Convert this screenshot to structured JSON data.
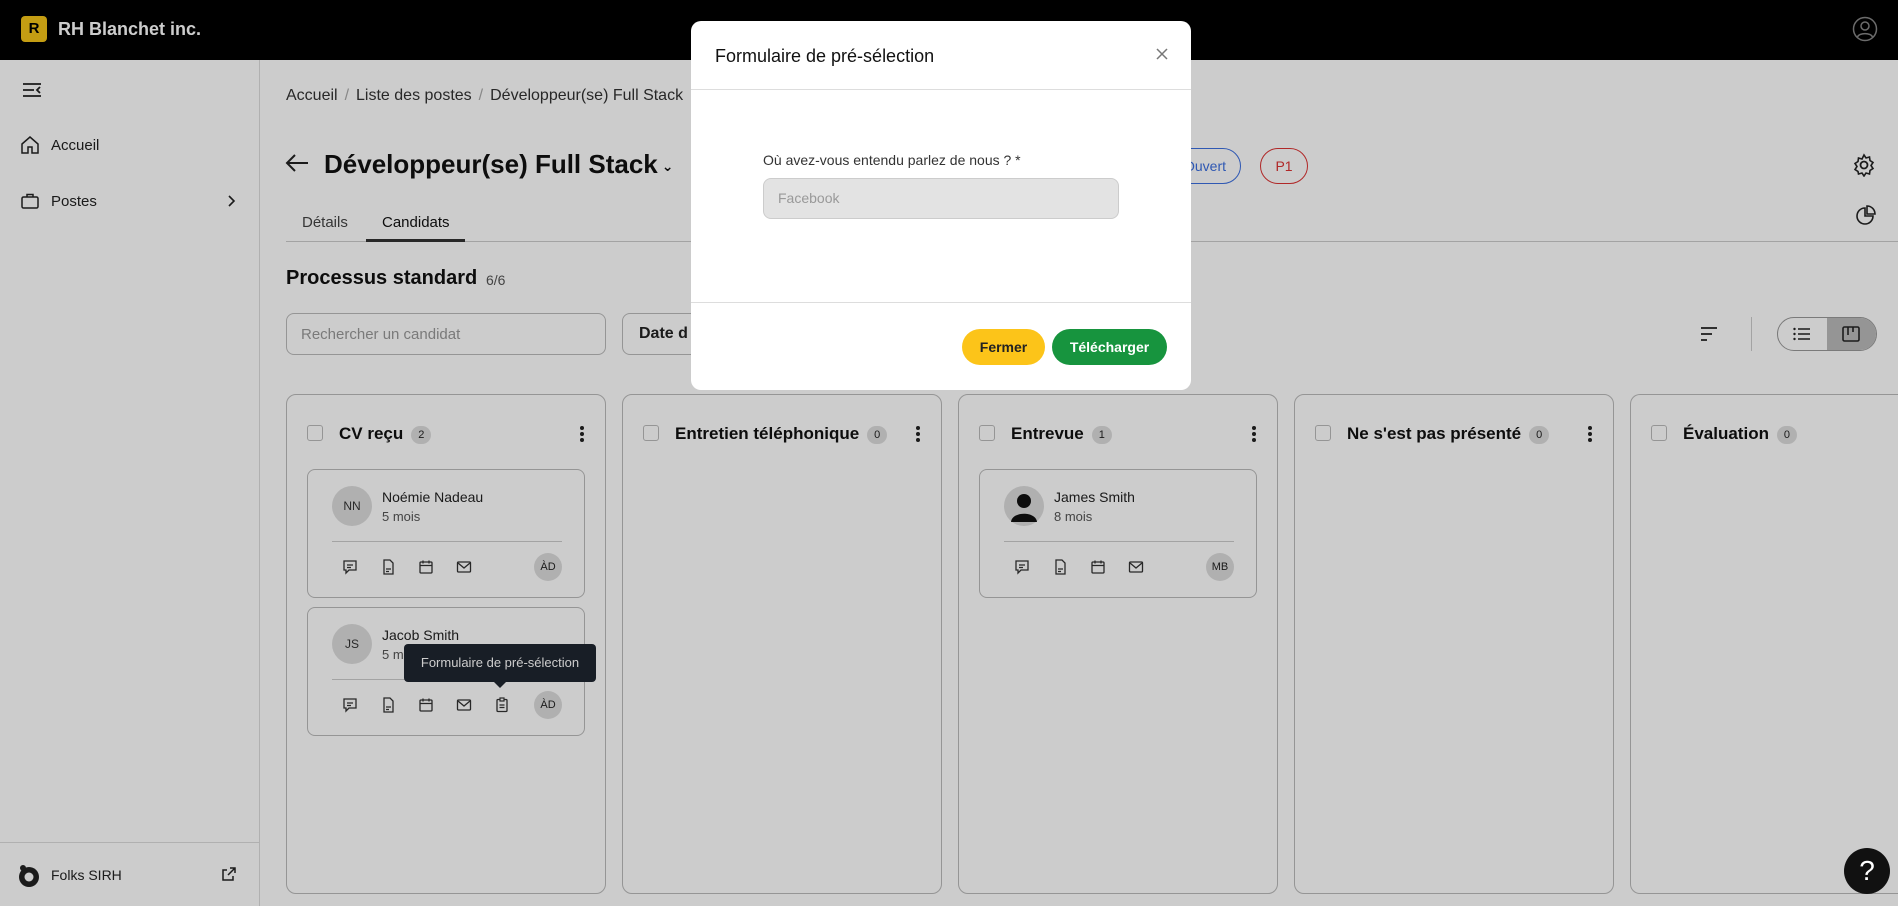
{
  "app": {
    "logo_letter": "R",
    "company": "RH Blanchet inc."
  },
  "sidebar": {
    "items": [
      {
        "label": "Accueil",
        "icon": "home-icon"
      },
      {
        "label": "Postes",
        "icon": "briefcase-icon"
      }
    ],
    "footer": {
      "label": "Folks SIRH"
    }
  },
  "breadcrumb": {
    "items": [
      "Accueil",
      "Liste des postes",
      "Développeur(se) Full Stack"
    ]
  },
  "page": {
    "title": "Développeur(se) Full Stack",
    "title_caret": "⌄",
    "status_badge": "Ouvert",
    "priority_badge": "P1",
    "tabs": [
      "Détails",
      "Candidats"
    ],
    "active_tab": "Candidats"
  },
  "process": {
    "name": "Processus standard",
    "count": "6/6",
    "search_placeholder": "Rechercher un candidat",
    "date_button": "Date d"
  },
  "columns": [
    {
      "title": "CV reçu",
      "count": "2",
      "cards": [
        {
          "initials": "NN",
          "name": "Noémie Nadeau",
          "age": "5 mois",
          "assignee": "ÀD"
        },
        {
          "initials": "JS",
          "name": "Jacob Smith",
          "age": "5 mois",
          "assignee": "ÀD"
        }
      ]
    },
    {
      "title": "Entretien téléphonique",
      "count": "0",
      "cards": []
    },
    {
      "title": "Entrevue",
      "count": "1",
      "cards": [
        {
          "initials": "",
          "name": "James Smith",
          "age": "8 mois",
          "assignee": "MB"
        }
      ]
    },
    {
      "title": "Ne s'est pas présenté",
      "count": "0",
      "cards": []
    },
    {
      "title": "Évaluation",
      "count": "0",
      "cards": []
    }
  ],
  "tooltip": {
    "text": "Formulaire de pré-sélection"
  },
  "modal": {
    "title": "Formulaire de pré-sélection",
    "question": "Où avez-vous entendu parlez de nous ? *",
    "answer": "Facebook",
    "close_label": "Fermer",
    "download_label": "Télécharger"
  },
  "help": {
    "label": "?"
  },
  "colors": {
    "accent_yellow": "#fcc419",
    "download_green": "#17943e",
    "status_blue": "#3b6fe0",
    "priority_red": "#dd3333",
    "topbar": "#000000"
  }
}
